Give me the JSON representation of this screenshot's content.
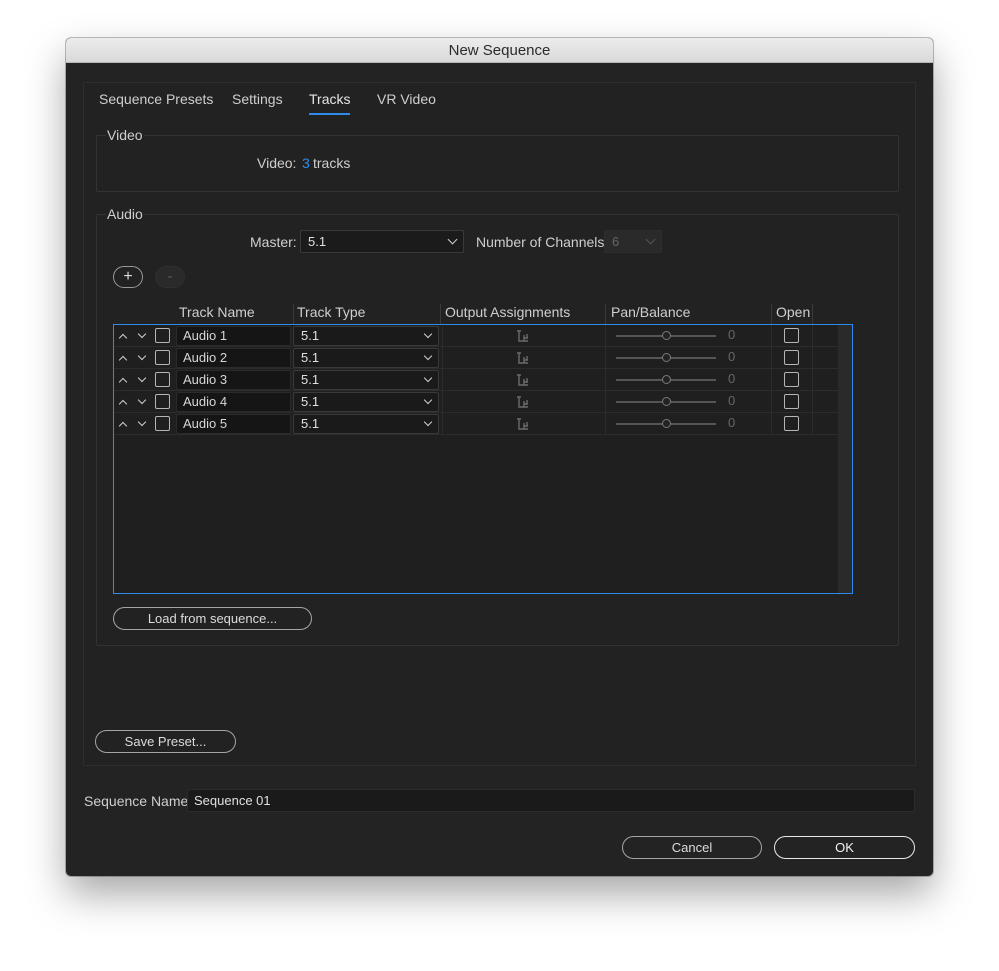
{
  "window": {
    "title": "New Sequence"
  },
  "tabs": [
    {
      "label": "Sequence Presets",
      "active": false
    },
    {
      "label": "Settings",
      "active": false
    },
    {
      "label": "Tracks",
      "active": true
    },
    {
      "label": "VR Video",
      "active": false
    }
  ],
  "video": {
    "group_label": "Video",
    "field_label": "Video:",
    "track_count": "3",
    "track_unit": "tracks"
  },
  "audio": {
    "group_label": "Audio",
    "master_label": "Master:",
    "master_value": "5.1",
    "channels_label": "Number of Channels:",
    "channels_value": "6",
    "add_button": "+",
    "remove_button": "-",
    "columns": [
      "Track Name",
      "Track Type",
      "Output Assignments",
      "Pan/Balance",
      "Open"
    ],
    "tracks": [
      {
        "name": "Audio 1",
        "type": "5.1",
        "pan": "0",
        "pan_fraction": 0.5
      },
      {
        "name": "Audio 2",
        "type": "5.1",
        "pan": "0",
        "pan_fraction": 0.5
      },
      {
        "name": "Audio 3",
        "type": "5.1",
        "pan": "0",
        "pan_fraction": 0.5
      },
      {
        "name": "Audio 4",
        "type": "5.1",
        "pan": "0",
        "pan_fraction": 0.5
      },
      {
        "name": "Audio 5",
        "type": "5.1",
        "pan": "0",
        "pan_fraction": 0.5
      }
    ],
    "load_button": "Load from sequence..."
  },
  "save_preset_button": "Save Preset...",
  "sequence_name": {
    "label": "Sequence Name:",
    "value": "Sequence 01"
  },
  "footer": {
    "cancel_label": "Cancel",
    "ok_label": "OK"
  },
  "colors": {
    "accent": "#2d8ceb",
    "background": "#232323"
  }
}
